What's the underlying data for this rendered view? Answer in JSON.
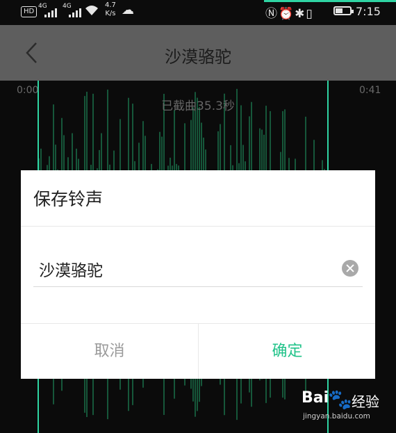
{
  "status_bar": {
    "hd": "HD",
    "signal1": "4G",
    "signal2": "4G",
    "speed_value": "4.7",
    "speed_unit": "K/s",
    "time": "7:15",
    "battery_level": 0.5,
    "icons": [
      "hd-icon",
      "signal-icon",
      "signal-icon",
      "wifi-icon",
      "cloud-icon",
      "nfc-icon",
      "alarm-icon",
      "bluetooth-icon",
      "vibrate-icon",
      "battery-icon"
    ]
  },
  "header": {
    "title": "沙漠骆驼",
    "back_icon": "chevron-left-icon"
  },
  "waveform": {
    "start_time": "0:00",
    "end_time": "0:41",
    "trim_info": "已截曲35.3秒",
    "bar_color": "#1e8a5a",
    "handle_color": "#2fd4a3"
  },
  "dialog": {
    "title": "保存铃声",
    "input_value": "沙漠骆驼",
    "clear_icon": "clear-icon",
    "cancel_label": "取消",
    "confirm_label": "确定",
    "confirm_color": "#22c38a"
  },
  "watermark": {
    "logo_text": "Bai",
    "paw": "du",
    "brand": "经验",
    "url": "jingyan.baidu.com"
  }
}
